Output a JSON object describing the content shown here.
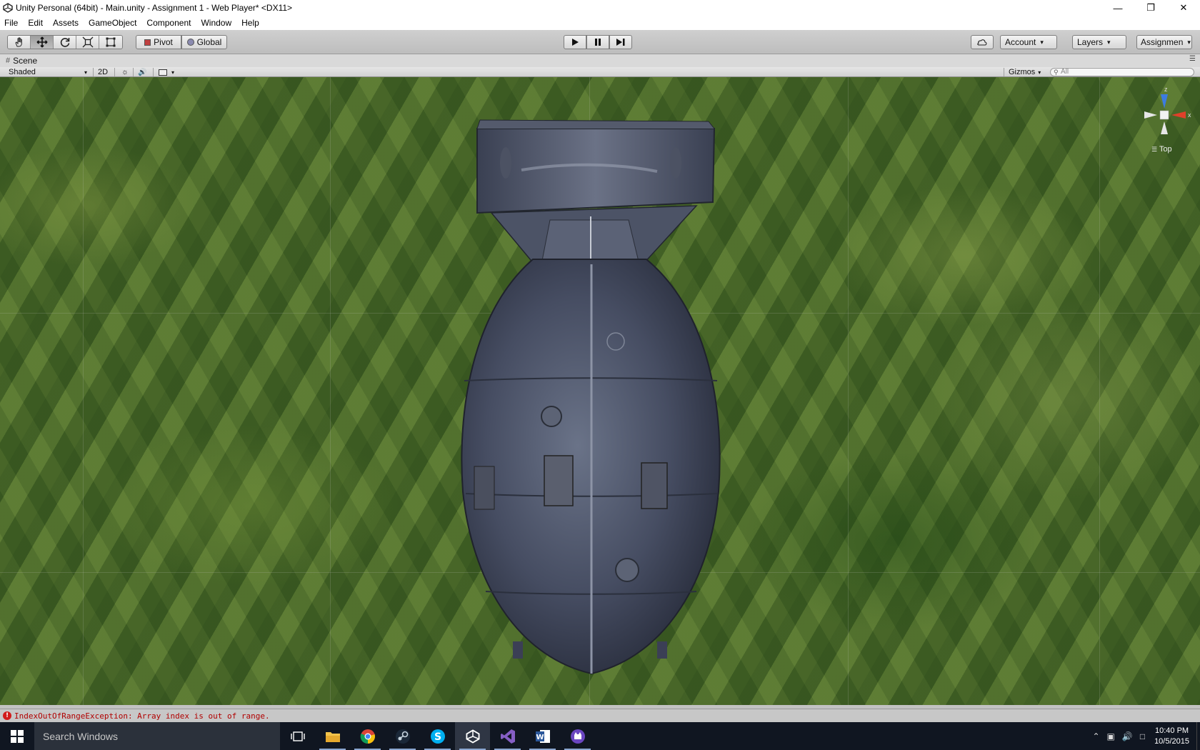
{
  "window": {
    "title": "Unity Personal (64bit) - Main.unity - Assignment 1 - Web Player* <DX11>",
    "buttons": [
      "minimize",
      "restore",
      "close"
    ]
  },
  "menu": [
    "File",
    "Edit",
    "Assets",
    "GameObject",
    "Component",
    "Window",
    "Help"
  ],
  "toolbar": {
    "tools": [
      "hand-tool",
      "move-tool",
      "rotate-tool",
      "scale-tool",
      "rect-tool"
    ],
    "active_tool": "move-tool",
    "pivot_label": "Pivot",
    "global_label": "Global",
    "play_controls": [
      "play",
      "pause",
      "step"
    ],
    "account_label": "Account",
    "layers_label": "Layers",
    "layout_label": "Assignmen"
  },
  "scene": {
    "tab_label": "Scene",
    "shading_mode": "Shaded",
    "mode_2d": "2D",
    "gizmos_label": "Gizmos",
    "search_placeholder": "All",
    "view_label": "Top",
    "axis_labels": {
      "z": "z",
      "x": "x"
    },
    "object": "aerial bomb model viewed from top over grass texture"
  },
  "status": {
    "message": "IndexOutOfRangeException: Array index is out of range.",
    "level": "error"
  },
  "taskbar": {
    "search_placeholder": "Search Windows",
    "apps": [
      "task-view",
      "file-explorer",
      "chrome",
      "steam",
      "skype",
      "unity",
      "visual-studio",
      "word",
      "game-app"
    ],
    "active_app": "unity",
    "time": "10:40 PM",
    "date": "10/5/2015"
  }
}
